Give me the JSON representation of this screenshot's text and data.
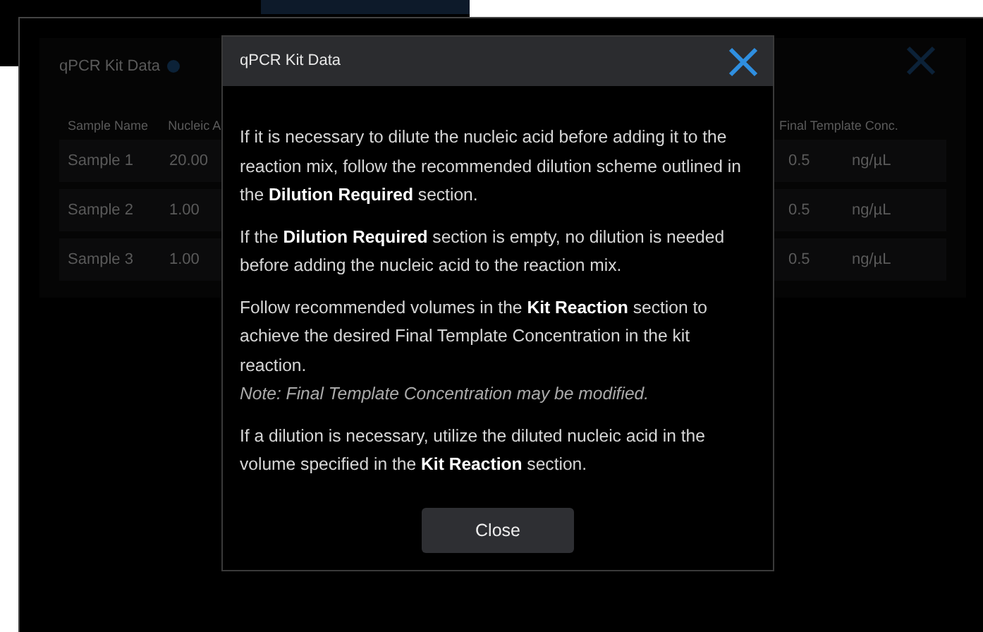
{
  "background_panel": {
    "title": "qPCR Kit Data",
    "columns": [
      "Sample Name",
      "Nucleic A",
      "Final Template Conc."
    ],
    "rows": [
      {
        "name": "Sample 1",
        "volume": "20.00",
        "conc": "0.5",
        "unit": "ng/µL"
      },
      {
        "name": "Sample 2",
        "volume": "1.00",
        "conc": "0.5",
        "unit": "ng/µL"
      },
      {
        "name": "Sample 3",
        "volume": "1.00",
        "conc": "0.5",
        "unit": "ng/µL"
      }
    ]
  },
  "dialog": {
    "title": "qPCR Kit Data",
    "paragraphs": [
      {
        "kind": "text",
        "text": "If it is necessary to dilute the nucleic acid before adding it to the reaction mix, follow the recommended dilution scheme outlined in the **Dilution Required** section."
      },
      {
        "kind": "text",
        "text": "If the **Dilution Required** section is empty, no dilution is needed before adding the nucleic acid to the reaction mix."
      },
      {
        "kind": "text",
        "text": "Follow recommended volumes in the **Kit Reaction** section to achieve the desired Final Template Concentration in the kit reaction."
      },
      {
        "kind": "note",
        "text": "Note: Final Template Concentration may be modified."
      },
      {
        "kind": "text",
        "text": "If a dilution is necessary, utilize the diluted nucleic acid in the volume specified in the **Kit Reaction** section."
      }
    ],
    "button": "Close"
  }
}
